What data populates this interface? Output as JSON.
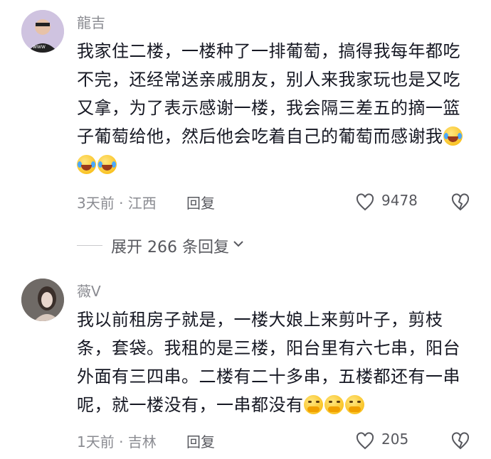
{
  "comments": [
    {
      "username": "龍吉",
      "avatar_caption": "WWW",
      "text": "我家住二楼，一楼种了一排葡萄，搞得我每年都吃不完，还经常送亲戚朋友，别人来我家玩也是又吃又拿，为了表示感谢一楼，我会隔三差五的摘一篮子葡萄给他，然后他会吃着自己的葡萄而感谢我",
      "emojis": [
        "laugh-cry-icon",
        "laugh-cry-icon",
        "laugh-cry-icon"
      ],
      "time_location": "3天前 · 江西",
      "reply_label": "回复",
      "like_count": "9478"
    },
    {
      "username": "薇V",
      "text": "我以前租房子就是，一楼大娘上来剪叶子，剪枝条，套袋。我租的是三楼，阳台里有六七串，阳台外面有三四串。二楼有二十多串，五楼都还有一串呢，就一楼没有，一串都没有",
      "emojis": [
        "smirk-icon",
        "smirk-icon",
        "smirk-icon"
      ],
      "time_location": "1天前 · 吉林",
      "reply_label": "回复",
      "like_count": "205"
    }
  ],
  "expand_replies": {
    "label": "展开 266 条回复"
  },
  "colors": {
    "text": "#161823",
    "muted": "#8a8b91",
    "emoji": "#f7b500"
  }
}
